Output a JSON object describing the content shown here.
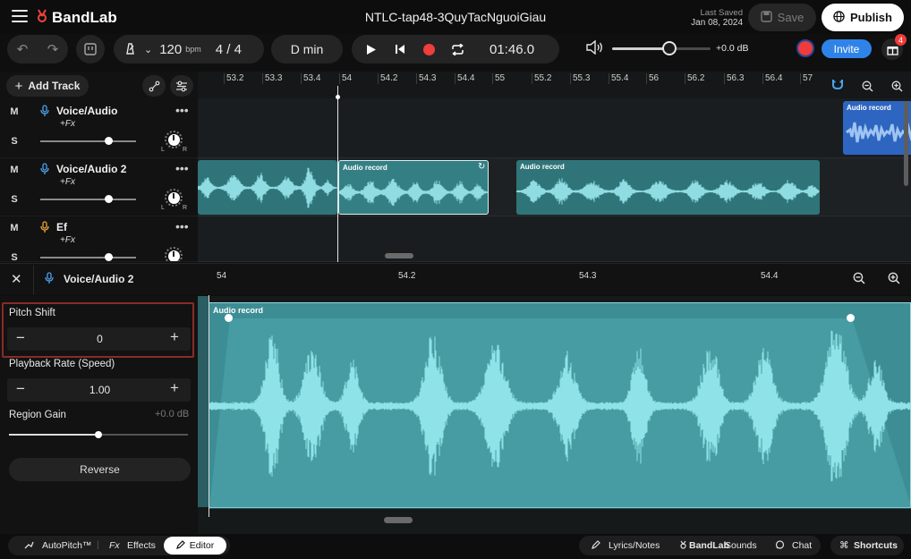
{
  "app": {
    "brand": "BandLab",
    "project_title": "NTLC-tap48-3QuyTacNguoiGiau",
    "last_saved_label": "Last Saved",
    "last_saved_date": "Jan 08, 2024",
    "save_label": "Save",
    "publish_label": "Publish"
  },
  "transport": {
    "bpm_value": "120",
    "bpm_unit": "bpm",
    "time_signature": "4 / 4",
    "key": "D min",
    "time": "01:46.0",
    "volume_db": "+0.0 dB",
    "volume_level": 0.58,
    "invite_label": "Invite",
    "notification_count": "4"
  },
  "tracks_header": {
    "add_track_label": "Add Track"
  },
  "ruler": {
    "ticks": [
      "53.2",
      "53.3",
      "53.4",
      "54",
      "54.2",
      "54.3",
      "54.4",
      "55",
      "55.2",
      "55.3",
      "55.4",
      "56",
      "56.2",
      "56.3",
      "56.4",
      "57"
    ]
  },
  "tracks": [
    {
      "mute": "M",
      "solo": "S",
      "name": "Voice/Audio",
      "fx": "+Fx",
      "pan_l": "L",
      "pan_r": "R",
      "mic_color": "#4aa3f0"
    },
    {
      "mute": "M",
      "solo": "S",
      "name": "Voice/Audio 2",
      "fx": "+Fx",
      "pan_l": "L",
      "pan_r": "R",
      "mic_color": "#4aa3f0"
    },
    {
      "mute": "M",
      "solo": "S",
      "name": "Ef",
      "fx": "+Fx",
      "pan_l": "L",
      "pan_r": "R",
      "mic_color": "#f0a53a"
    }
  ],
  "clips": {
    "label": "Audio record",
    "colors": {
      "track2": "#3c8f95",
      "track1": "#3a6fc8"
    }
  },
  "editor": {
    "track_name": "Voice/Audio 2",
    "ticks": [
      "54",
      "54.2",
      "54.3",
      "54.4"
    ],
    "region_label": "Audio record",
    "pitch_shift_label": "Pitch Shift",
    "pitch_shift_value": "0",
    "playback_rate_label": "Playback Rate (Speed)",
    "playback_rate_value": "1.00",
    "region_gain_label": "Region Gain",
    "region_gain_value": "+0.0 dB",
    "region_gain_level": 0.5,
    "reverse_label": "Reverse"
  },
  "bottom": {
    "autopitch_label": "AutoPitch™",
    "effects_prefix": "Fx",
    "effects_label": "Effects",
    "editor_label": "Editor",
    "lyrics_label": "Lyrics/Notes",
    "sounds_brand": "BandLab",
    "sounds_label": "Sounds",
    "chat_label": "Chat",
    "shortcuts_label": "Shortcuts"
  }
}
